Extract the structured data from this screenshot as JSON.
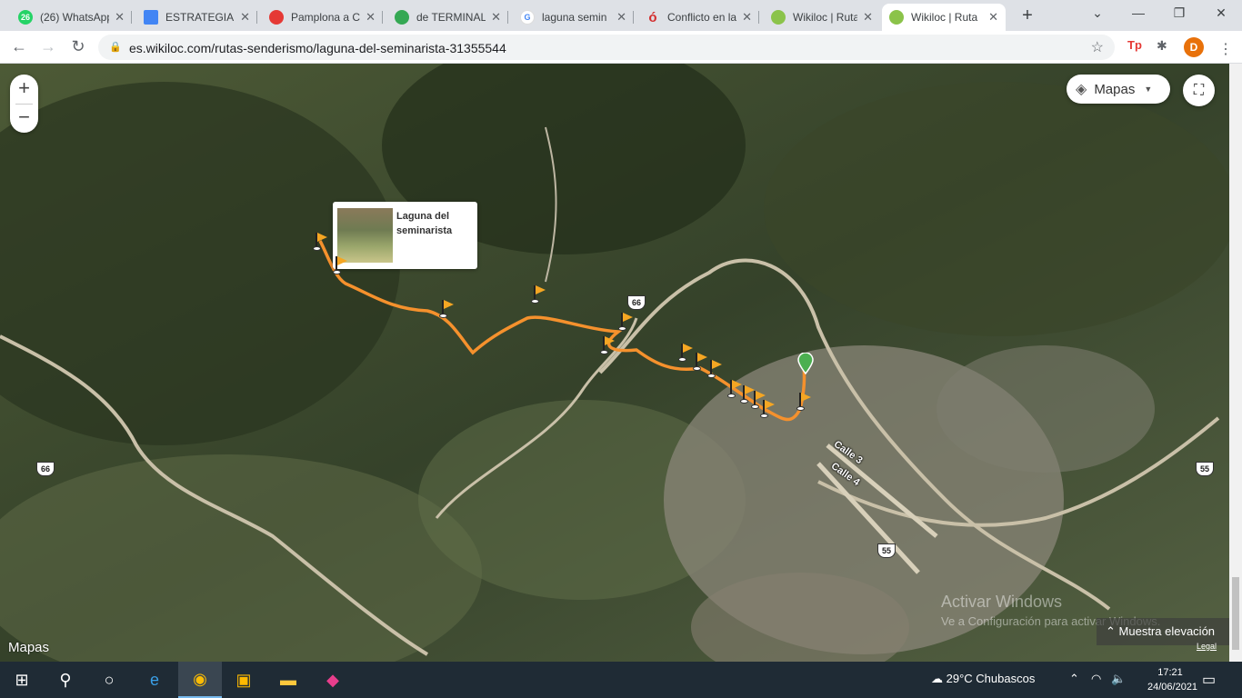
{
  "browser": {
    "tabs": [
      {
        "label": "(26) WhatsApp",
        "favicon": "whatsapp-icon",
        "badge": "26",
        "color": "#25d366",
        "active": false
      },
      {
        "label": "ESTRATEGIA D",
        "favicon": "docs-icon",
        "color": "#4285f4",
        "active": false
      },
      {
        "label": "Pamplona a C",
        "favicon": "bus-icon",
        "color": "#e53935",
        "active": false
      },
      {
        "label": "de TERMINAL",
        "favicon": "maps-pin-icon",
        "color": "#34a853",
        "active": false
      },
      {
        "label": "laguna semin",
        "favicon": "google-icon",
        "color": "#4285f4",
        "active": false
      },
      {
        "label": "Conflicto en la",
        "favicon": "opera-o-icon",
        "color": "#d32f2f",
        "active": false
      },
      {
        "label": "Wikiloc | Ruta",
        "favicon": "wikiloc-icon",
        "color": "#8bc34a",
        "active": false
      },
      {
        "label": "Wikiloc | Ruta",
        "favicon": "wikiloc-icon",
        "color": "#8bc34a",
        "active": true
      }
    ],
    "url": "es.wikiloc.com/rutas-senderismo/laguna-del-seminarista-31355544",
    "profile_initial": "D"
  },
  "map": {
    "zoom_in": "+",
    "zoom_out": "−",
    "map_type_label": "Mapas",
    "popup_title": "Laguna del seminarista",
    "route_color": "#f5912d",
    "flag_color": "#f5a623",
    "start_pin_color": "#4caf50",
    "road_shields": [
      "66",
      "66",
      "55",
      "55"
    ],
    "street_labels": [
      "Calle 3",
      "Calle 4"
    ],
    "attribution": "Mapas",
    "elevation_button": "Muestra elevación",
    "legal": "Legal",
    "watermark_title": "Activar Windows",
    "watermark_sub": "Ve a Configuración para activar Windows."
  },
  "taskbar": {
    "weather_temp": "29°C",
    "weather_text": "Chubascos",
    "time": "17:21",
    "date": "24/06/2021"
  }
}
